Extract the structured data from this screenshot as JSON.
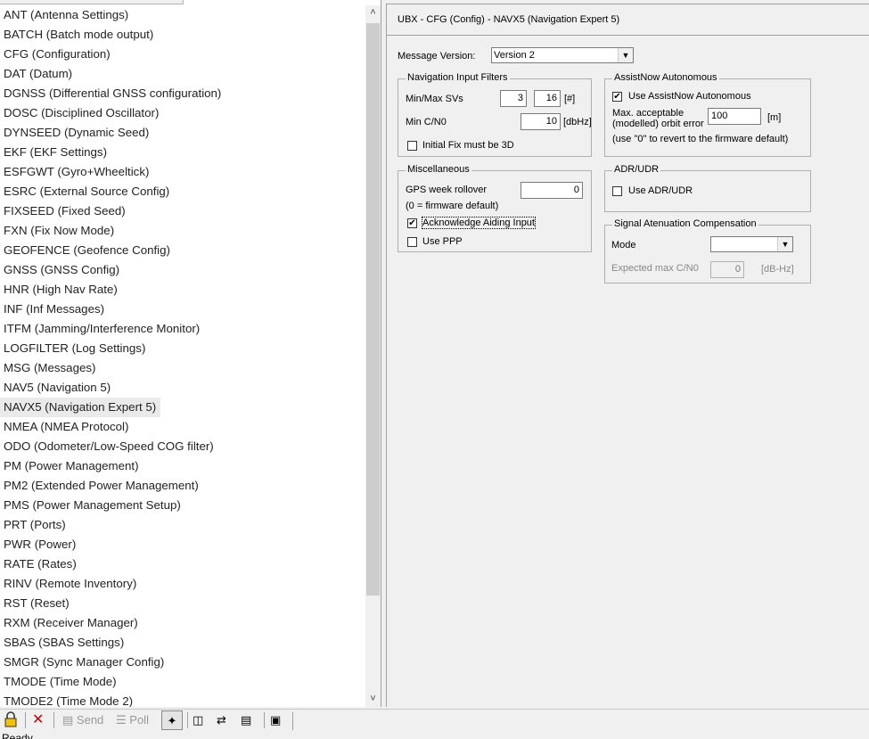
{
  "messages": [
    "ANT (Antenna Settings)",
    "BATCH (Batch mode output)",
    "CFG (Configuration)",
    "DAT (Datum)",
    "DGNSS (Differential GNSS configuration)",
    "DOSC (Disciplined Oscillator)",
    "DYNSEED (Dynamic Seed)",
    "EKF (EKF Settings)",
    "ESFGWT (Gyro+Wheeltick)",
    "ESRC (External Source Config)",
    "FIXSEED (Fixed Seed)",
    "FXN (Fix Now Mode)",
    "GEOFENCE (Geofence Config)",
    "GNSS (GNSS Config)",
    "HNR (High Nav Rate)",
    "INF (Inf Messages)",
    "ITFM (Jamming/Interference Monitor)",
    "LOGFILTER (Log Settings)",
    "MSG (Messages)",
    "NAV5 (Navigation 5)",
    "NAVX5 (Navigation Expert 5)",
    "NMEA (NMEA Protocol)",
    "ODO (Odometer/Low-Speed COG filter)",
    "PM (Power Management)",
    "PM2 (Extended Power Management)",
    "PMS (Power Management Setup)",
    "PRT (Ports)",
    "PWR (Power)",
    "RATE (Rates)",
    "RINV (Remote Inventory)",
    "RST (Reset)",
    "RXM (Receiver Manager)",
    "SBAS (SBAS Settings)",
    "SMGR (Sync Manager Config)",
    "TMODE (Time Mode)",
    "TMODE2 (Time Mode 2)"
  ],
  "selected_index": 20,
  "panel": {
    "title": "UBX - CFG (Config) - NAVX5 (Navigation Expert 5)",
    "message_version_label": "Message Version:",
    "message_version_value": "Version 2"
  },
  "nav_filters": {
    "title": "Navigation Input Filters",
    "minmax_label": "Min/Max SVs",
    "min_svs": "3",
    "max_svs": "16",
    "svs_unit": "[#]",
    "mincno_label": "Min C/N0",
    "mincno_value": "10",
    "mincno_unit": "[dbHz]",
    "initfix_label": "Initial Fix must be 3D",
    "initfix_checked": false
  },
  "assistnow": {
    "title": "AssistNow Autonomous",
    "use_label": "Use AssistNow Autonomous",
    "use_checked": "✔",
    "orbit_label1": "Max. acceptable",
    "orbit_label2": "(modelled) orbit error",
    "orbit_value": "100",
    "orbit_unit": "[m]",
    "hint": "(use \"0\" to revert to the firmware default)"
  },
  "misc": {
    "title": "Miscellaneous",
    "rollover_label": "GPS week rollover",
    "rollover_value": "0",
    "rollover_hint": "(0 = firmware default)",
    "ack_label": "Acknowledge Aiding Input",
    "ack_checked": "✔",
    "ppp_label": "Use PPP"
  },
  "adr": {
    "title": "ADR/UDR",
    "use_label": "Use ADR/UDR"
  },
  "sig_atten": {
    "title": "Signal Atenuation Compensation",
    "mode_label": "Mode",
    "mode_value": "",
    "maxcno_label": "Expected max C/N0",
    "maxcno_value": "0",
    "maxcno_unit": "[dB-Hz]"
  },
  "toolbar": {
    "send_label": "Send",
    "poll_label": "Poll"
  },
  "status": {
    "text": "Ready"
  }
}
